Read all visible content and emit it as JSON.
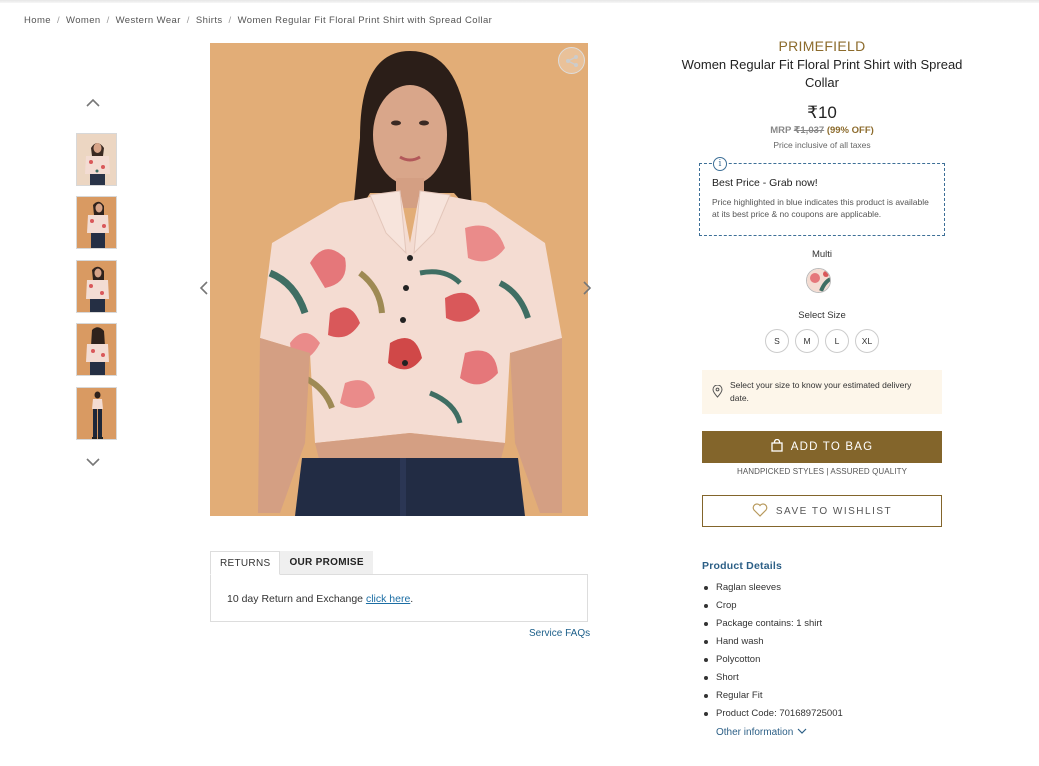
{
  "breadcrumb": {
    "items": [
      "Home",
      "Women",
      "Western Wear",
      "Shirts",
      "Women Regular Fit Floral Print Shirt with Spread Collar"
    ],
    "separator": "/"
  },
  "gallery": {
    "thumbnail_count": 5,
    "up_icon": "chevron-up-icon",
    "down_icon": "chevron-down-icon",
    "share_icon": "share-icon",
    "prev_icon": "chevron-left-icon",
    "next_icon": "chevron-right-icon"
  },
  "tabs": {
    "items": [
      "RETURNS",
      "OUR PROMISE"
    ],
    "active": "RETURNS",
    "returns_text": "10 day Return and Exchange ",
    "returns_link": "click here",
    "returns_suffix": ".",
    "service_faqs": "Service FAQs"
  },
  "product": {
    "brand": "PRIMEFIELD",
    "title": "Women Regular Fit Floral Print Shirt with Spread Collar",
    "price": "₹10",
    "mrp_label": "MRP",
    "mrp_value": "₹1,037",
    "discount": "(99% OFF)",
    "tax_note": "Price inclusive of all taxes"
  },
  "best_price": {
    "icon": "info-icon",
    "icon_glyph": "i",
    "title": "Best Price - Grab now!",
    "description": "Price highlighted in blue indicates this product is available at its best price & no coupons are applicable."
  },
  "color": {
    "label": "Multi"
  },
  "size": {
    "label": "Select Size",
    "options": [
      "S",
      "M",
      "L",
      "XL"
    ]
  },
  "delivery": {
    "icon": "location-pin-icon",
    "text": "Select your size to know your estimated delivery date."
  },
  "actions": {
    "add_to_bag": "ADD TO BAG",
    "add_to_bag_icon": "shopping-bag-icon",
    "handpicked": "HANDPICKED STYLES | ASSURED QUALITY",
    "wishlist": "SAVE TO WISHLIST",
    "wishlist_icon": "heart-icon"
  },
  "details": {
    "title": "Product Details",
    "items": [
      "Raglan sleeves",
      "Crop",
      "Package contains: 1 shirt",
      "Hand wash",
      "Polycotton",
      "Short",
      "Regular Fit",
      "Product Code: 701689725001"
    ],
    "other_info": "Other information"
  },
  "colors": {
    "brand_gold": "#8c6b2c",
    "button_brown": "#83652b",
    "link_blue": "#2c5f86",
    "image_background": "#e2ad77"
  }
}
